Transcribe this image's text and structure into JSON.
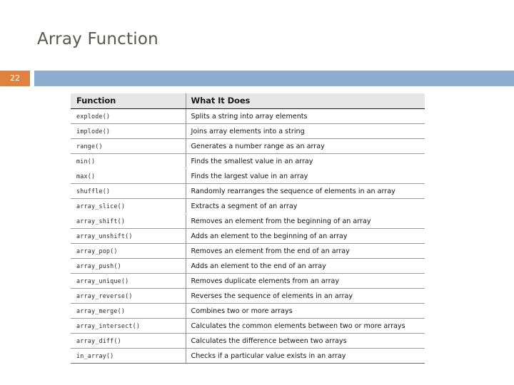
{
  "slide": {
    "title": "Array Function",
    "page_number": "22",
    "accent_orange": "#e1813f",
    "accent_blue": "#8cadcd",
    "title_color": "#5a5550"
  },
  "table": {
    "headers": {
      "function": "Function",
      "description": "What It Does"
    },
    "rows": [
      {
        "fn": "explode()",
        "desc": "Splits a string into array elements"
      },
      {
        "fn": "implode()",
        "desc": "Joins array elements into a string"
      },
      {
        "fn": "range()",
        "desc": "Generates a number range as an array"
      },
      {
        "fn": "min()",
        "desc": "Finds the smallest value in an array"
      },
      {
        "fn": "max()",
        "desc": "Finds the largest value in an array"
      },
      {
        "fn": "shuffle()",
        "desc": "Randomly rearranges the sequence of elements in an array"
      },
      {
        "fn": "array_slice()",
        "desc": "Extracts a segment of an array"
      },
      {
        "fn": "array_shift()",
        "desc": "Removes an element from the beginning of an array"
      },
      {
        "fn": "array_unshift()",
        "desc": "Adds an element to the beginning of an array"
      },
      {
        "fn": "array_pop()",
        "desc": "Removes an element from the end of an array"
      },
      {
        "fn": "array_push()",
        "desc": "Adds an element to the end of an array"
      },
      {
        "fn": "array_unique()",
        "desc": "Removes duplicate elements from an array"
      },
      {
        "fn": "array_reverse()",
        "desc": "Reverses the sequence of elements in an array"
      },
      {
        "fn": "array_merge()",
        "desc": "Combines two or more arrays"
      },
      {
        "fn": "array_intersect()",
        "desc": "Calculates the common elements between two or more arrays"
      },
      {
        "fn": "array_diff()",
        "desc": "Calculates the difference between two arrays"
      },
      {
        "fn": "in_array()",
        "desc": "Checks if a particular value exists in an array"
      }
    ]
  }
}
